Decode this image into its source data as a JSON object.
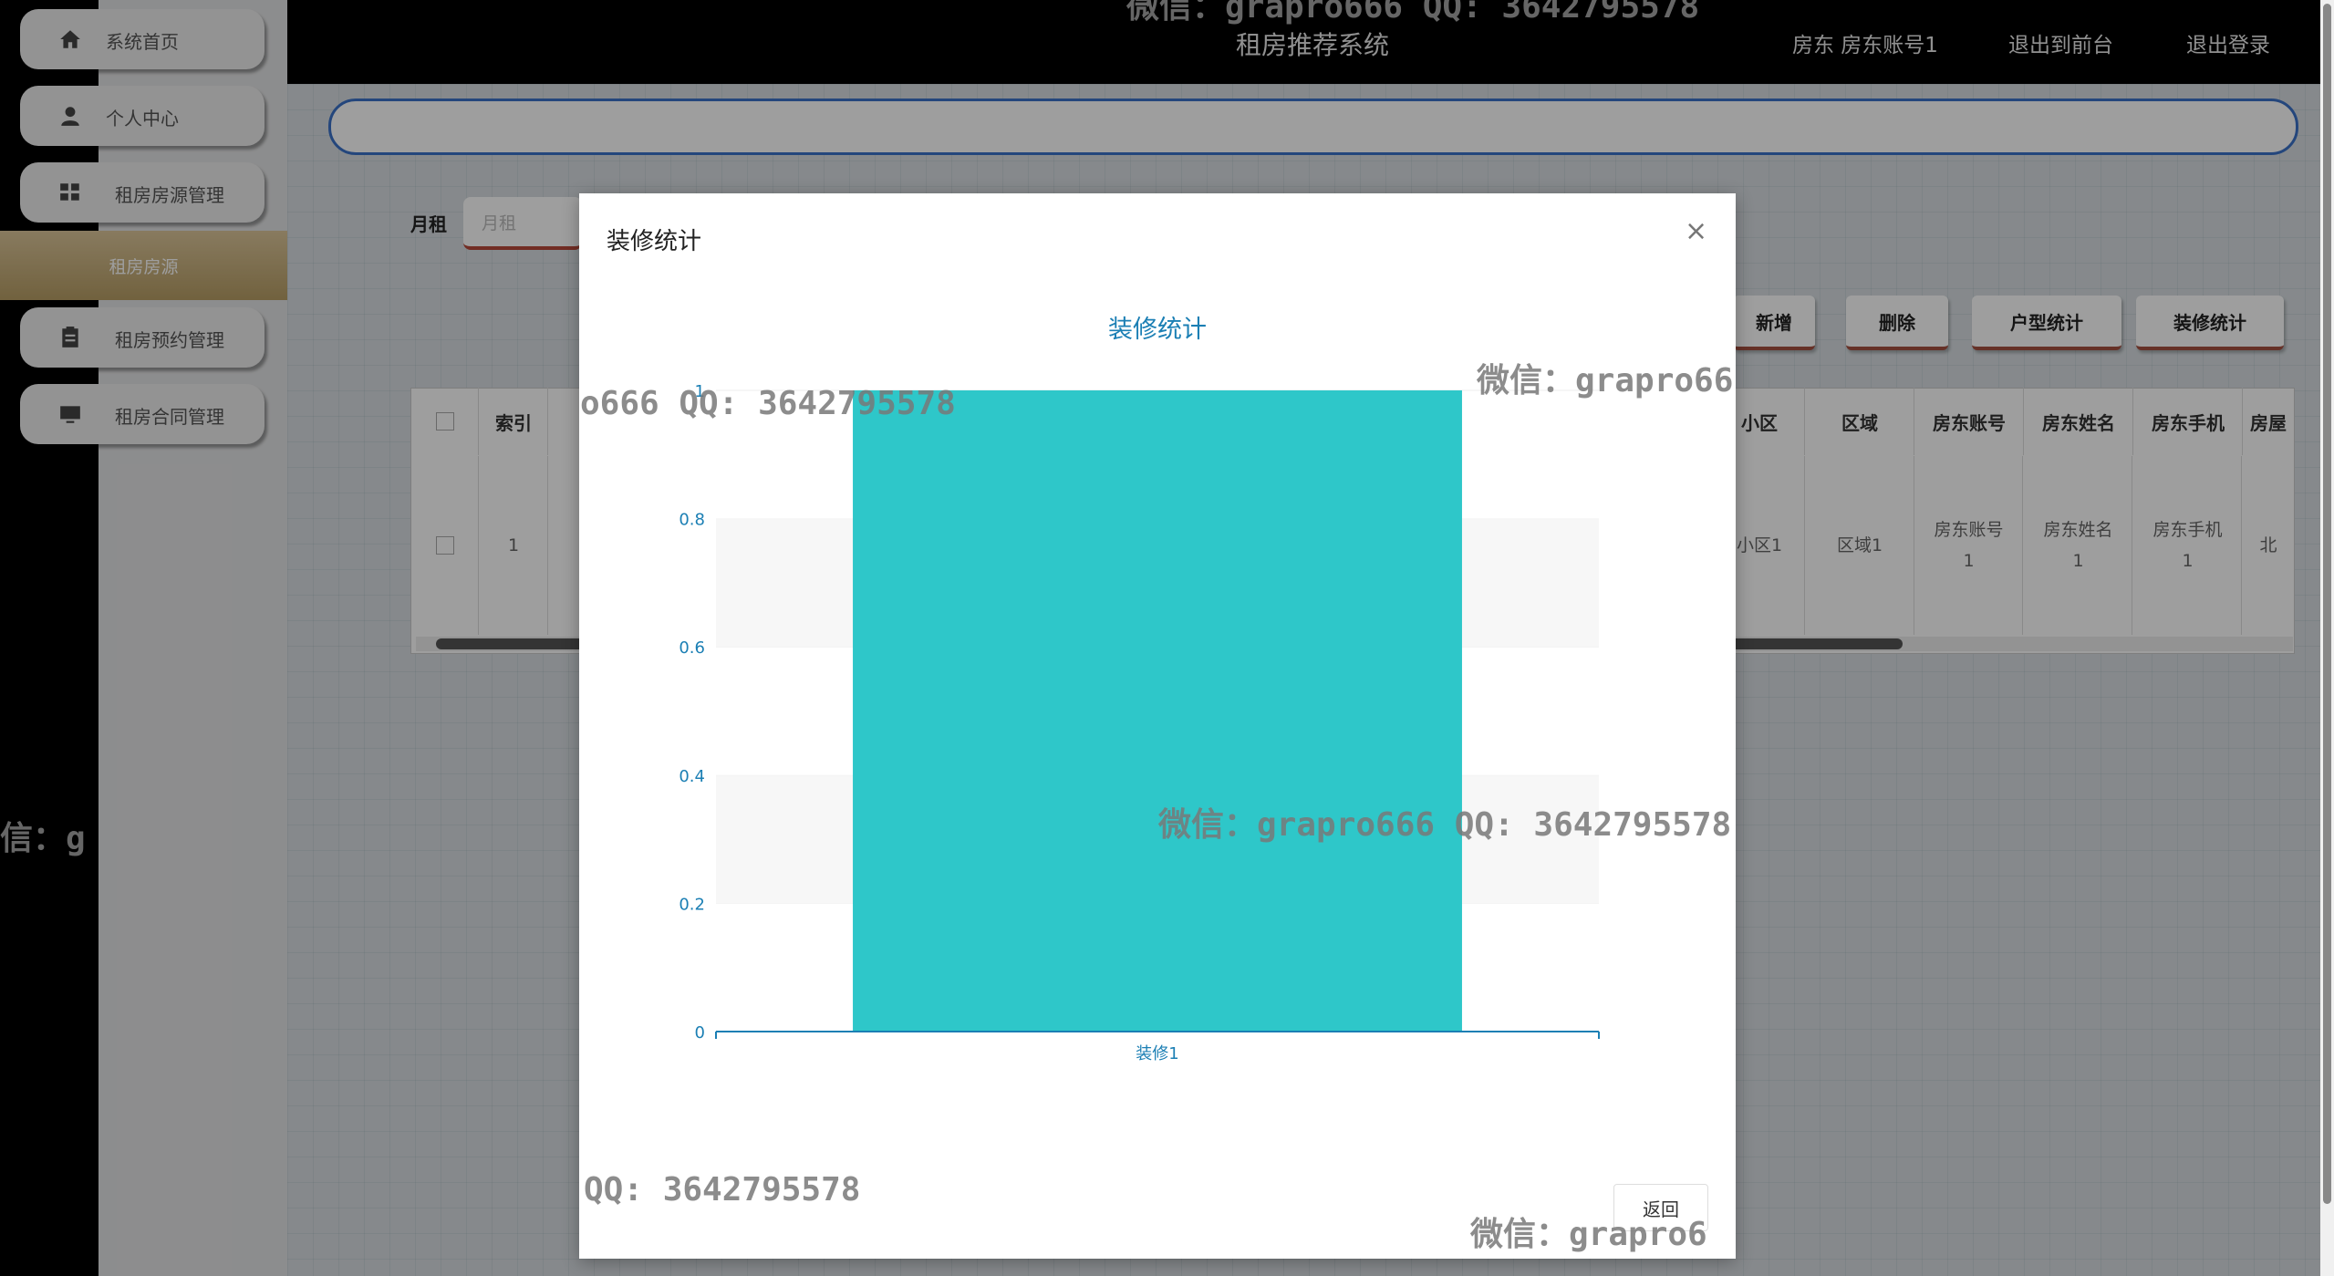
{
  "header": {
    "title": "租房推荐系统",
    "user": "房东 房东账号1",
    "to_front": "退出到前台",
    "logout": "退出登录"
  },
  "sidebar": {
    "items": [
      {
        "label": "系统首页",
        "icon": "home-icon"
      },
      {
        "label": "个人中心",
        "icon": "user-icon"
      },
      {
        "label": "租房房源管理",
        "icon": "grid-icon"
      },
      {
        "label": "租房预约管理",
        "icon": "clipboard-icon"
      },
      {
        "label": "租房合同管理",
        "icon": "monitor-icon"
      }
    ],
    "sub_item": "租房房源"
  },
  "search": {
    "rent_label": "月租",
    "rent_placeholder": "月租"
  },
  "actions": {
    "add": "新增",
    "delete": "删除",
    "room_type_stats": "户型统计",
    "decoration_stats": "装修统计"
  },
  "table": {
    "headers": {
      "index": "索引",
      "community": "小区",
      "area": "区域",
      "landlord_account": "房东账号",
      "landlord_name": "房东姓名",
      "landlord_phone": "房东手机",
      "more": "房屋"
    },
    "row": {
      "index": "1",
      "community": "小区1",
      "area": "区域1",
      "landlord_account": "房东账号1",
      "landlord_name": "房东姓名1",
      "landlord_phone": "房东手机1",
      "more": "北"
    }
  },
  "modal": {
    "title": "装修统计",
    "close": "×",
    "return_label": "返回"
  },
  "chart_data": {
    "type": "bar",
    "title": "装修统计",
    "categories": [
      "装修1"
    ],
    "values": [
      1
    ],
    "ylim": [
      0,
      1
    ],
    "yticks": [
      "0",
      "0.2",
      "0.4",
      "0.6",
      "0.8",
      "1"
    ],
    "bar_color": "#2ec7c9",
    "axis_color": "#1b7fb4",
    "grid": "striped"
  },
  "watermarks": {
    "text_full": "微信：grapro666 QQ: 3642795578",
    "text_qq": "QQ: 3642795578",
    "text_partial_1": "o666 QQ: 3642795578",
    "text_partial_2": "微信：grapro66",
    "text_partial_3": "微信：grapro666 QQ: 3642795578",
    "text_partial_4": "信：g",
    "text_partial_5": "微信：grapro6",
    "text_top": "微信：grapro666 QQ: 3642795578"
  }
}
